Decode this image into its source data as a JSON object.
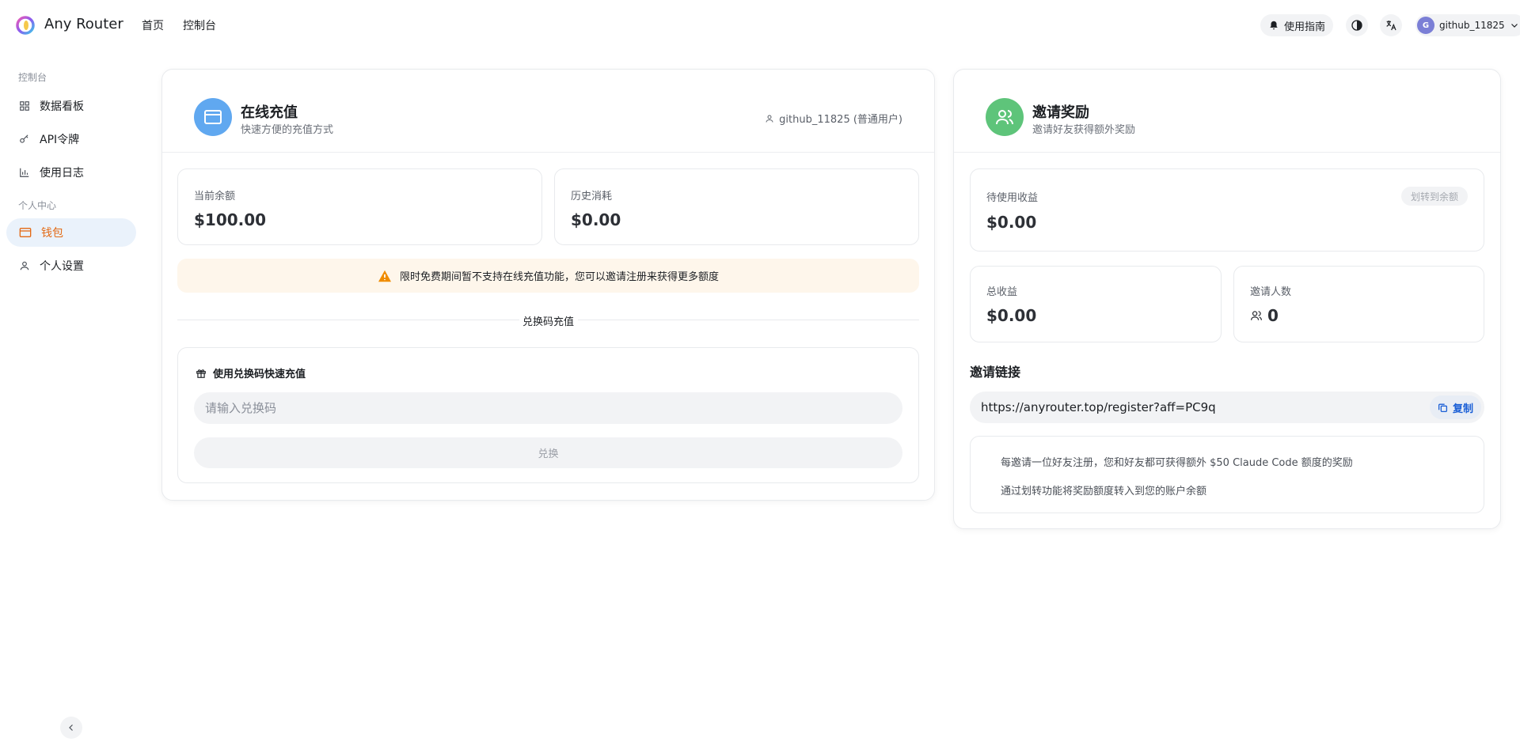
{
  "header": {
    "brand": "Any Router",
    "nav": [
      {
        "label": "首页"
      },
      {
        "label": "控制台"
      }
    ],
    "guide_label": "使用指南",
    "user": {
      "avatar_letter": "G",
      "name": "github_11825"
    }
  },
  "sidebar": {
    "sections": [
      {
        "title": "控制台",
        "items": [
          {
            "label": "数据看板"
          },
          {
            "label": "API令牌"
          },
          {
            "label": "使用日志"
          }
        ]
      },
      {
        "title": "个人中心",
        "items": [
          {
            "label": "钱包",
            "active": true
          },
          {
            "label": "个人设置"
          }
        ]
      }
    ]
  },
  "recharge": {
    "title": "在线充值",
    "subtitle": "快速方便的充值方式",
    "user_info": "github_11825 (普通用户)",
    "balance_label": "当前余额",
    "balance_value": "$100.00",
    "history_label": "历史消耗",
    "history_value": "$0.00",
    "notice": "限时免费期间暂不支持在线充值功能，您可以邀请注册来获得更多额度",
    "divider_text": "兑换码充值",
    "redeem_title": "使用兑换码快速充值",
    "redeem_placeholder": "请输入兑换码",
    "redeem_button": "兑换"
  },
  "invite": {
    "title": "邀请奖励",
    "subtitle": "邀请好友获得额外奖励",
    "pending_label": "待使用收益",
    "pending_value": "$0.00",
    "transfer_button": "划转到余额",
    "total_label": "总收益",
    "total_value": "$0.00",
    "count_label": "邀请人数",
    "count_value": "0",
    "link_label": "邀请链接",
    "link_value": "https://anyrouter.top/register?aff=PC9q",
    "copy_button": "复制",
    "info_lines": [
      "每邀请一位好友注册，您和好友都可获得额外 $50 Claude Code 额度的奖励",
      "通过划转功能将奖励额度转入到您的账户余额"
    ]
  },
  "colors": {
    "accent": "#e36a15",
    "active_bg": "#eaf2fb",
    "recharge_icon_bg": "#60a8f0",
    "invite_icon_bg": "#5ec47a",
    "warning": "#f08c00",
    "link_blue": "#1a5fd6"
  }
}
